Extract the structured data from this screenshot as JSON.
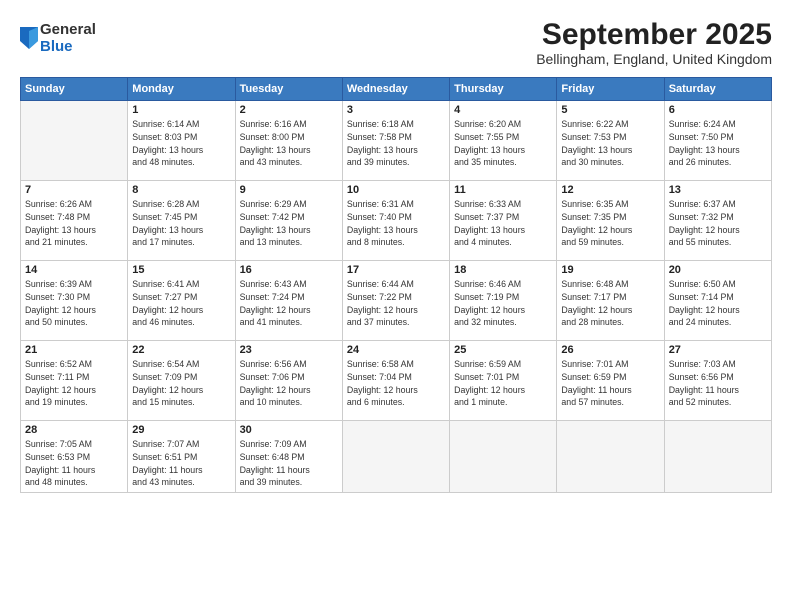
{
  "logo": {
    "general": "General",
    "blue": "Blue"
  },
  "title": "September 2025",
  "location": "Bellingham, England, United Kingdom",
  "weekdays": [
    "Sunday",
    "Monday",
    "Tuesday",
    "Wednesday",
    "Thursday",
    "Friday",
    "Saturday"
  ],
  "weeks": [
    [
      {
        "day": "",
        "info": ""
      },
      {
        "day": "1",
        "info": "Sunrise: 6:14 AM\nSunset: 8:03 PM\nDaylight: 13 hours\nand 48 minutes."
      },
      {
        "day": "2",
        "info": "Sunrise: 6:16 AM\nSunset: 8:00 PM\nDaylight: 13 hours\nand 43 minutes."
      },
      {
        "day": "3",
        "info": "Sunrise: 6:18 AM\nSunset: 7:58 PM\nDaylight: 13 hours\nand 39 minutes."
      },
      {
        "day": "4",
        "info": "Sunrise: 6:20 AM\nSunset: 7:55 PM\nDaylight: 13 hours\nand 35 minutes."
      },
      {
        "day": "5",
        "info": "Sunrise: 6:22 AM\nSunset: 7:53 PM\nDaylight: 13 hours\nand 30 minutes."
      },
      {
        "day": "6",
        "info": "Sunrise: 6:24 AM\nSunset: 7:50 PM\nDaylight: 13 hours\nand 26 minutes."
      }
    ],
    [
      {
        "day": "7",
        "info": "Sunrise: 6:26 AM\nSunset: 7:48 PM\nDaylight: 13 hours\nand 21 minutes."
      },
      {
        "day": "8",
        "info": "Sunrise: 6:28 AM\nSunset: 7:45 PM\nDaylight: 13 hours\nand 17 minutes."
      },
      {
        "day": "9",
        "info": "Sunrise: 6:29 AM\nSunset: 7:42 PM\nDaylight: 13 hours\nand 13 minutes."
      },
      {
        "day": "10",
        "info": "Sunrise: 6:31 AM\nSunset: 7:40 PM\nDaylight: 13 hours\nand 8 minutes."
      },
      {
        "day": "11",
        "info": "Sunrise: 6:33 AM\nSunset: 7:37 PM\nDaylight: 13 hours\nand 4 minutes."
      },
      {
        "day": "12",
        "info": "Sunrise: 6:35 AM\nSunset: 7:35 PM\nDaylight: 12 hours\nand 59 minutes."
      },
      {
        "day": "13",
        "info": "Sunrise: 6:37 AM\nSunset: 7:32 PM\nDaylight: 12 hours\nand 55 minutes."
      }
    ],
    [
      {
        "day": "14",
        "info": "Sunrise: 6:39 AM\nSunset: 7:30 PM\nDaylight: 12 hours\nand 50 minutes."
      },
      {
        "day": "15",
        "info": "Sunrise: 6:41 AM\nSunset: 7:27 PM\nDaylight: 12 hours\nand 46 minutes."
      },
      {
        "day": "16",
        "info": "Sunrise: 6:43 AM\nSunset: 7:24 PM\nDaylight: 12 hours\nand 41 minutes."
      },
      {
        "day": "17",
        "info": "Sunrise: 6:44 AM\nSunset: 7:22 PM\nDaylight: 12 hours\nand 37 minutes."
      },
      {
        "day": "18",
        "info": "Sunrise: 6:46 AM\nSunset: 7:19 PM\nDaylight: 12 hours\nand 32 minutes."
      },
      {
        "day": "19",
        "info": "Sunrise: 6:48 AM\nSunset: 7:17 PM\nDaylight: 12 hours\nand 28 minutes."
      },
      {
        "day": "20",
        "info": "Sunrise: 6:50 AM\nSunset: 7:14 PM\nDaylight: 12 hours\nand 24 minutes."
      }
    ],
    [
      {
        "day": "21",
        "info": "Sunrise: 6:52 AM\nSunset: 7:11 PM\nDaylight: 12 hours\nand 19 minutes."
      },
      {
        "day": "22",
        "info": "Sunrise: 6:54 AM\nSunset: 7:09 PM\nDaylight: 12 hours\nand 15 minutes."
      },
      {
        "day": "23",
        "info": "Sunrise: 6:56 AM\nSunset: 7:06 PM\nDaylight: 12 hours\nand 10 minutes."
      },
      {
        "day": "24",
        "info": "Sunrise: 6:58 AM\nSunset: 7:04 PM\nDaylight: 12 hours\nand 6 minutes."
      },
      {
        "day": "25",
        "info": "Sunrise: 6:59 AM\nSunset: 7:01 PM\nDaylight: 12 hours\nand 1 minute."
      },
      {
        "day": "26",
        "info": "Sunrise: 7:01 AM\nSunset: 6:59 PM\nDaylight: 11 hours\nand 57 minutes."
      },
      {
        "day": "27",
        "info": "Sunrise: 7:03 AM\nSunset: 6:56 PM\nDaylight: 11 hours\nand 52 minutes."
      }
    ],
    [
      {
        "day": "28",
        "info": "Sunrise: 7:05 AM\nSunset: 6:53 PM\nDaylight: 11 hours\nand 48 minutes."
      },
      {
        "day": "29",
        "info": "Sunrise: 7:07 AM\nSunset: 6:51 PM\nDaylight: 11 hours\nand 43 minutes."
      },
      {
        "day": "30",
        "info": "Sunrise: 7:09 AM\nSunset: 6:48 PM\nDaylight: 11 hours\nand 39 minutes."
      },
      {
        "day": "",
        "info": ""
      },
      {
        "day": "",
        "info": ""
      },
      {
        "day": "",
        "info": ""
      },
      {
        "day": "",
        "info": ""
      }
    ]
  ]
}
